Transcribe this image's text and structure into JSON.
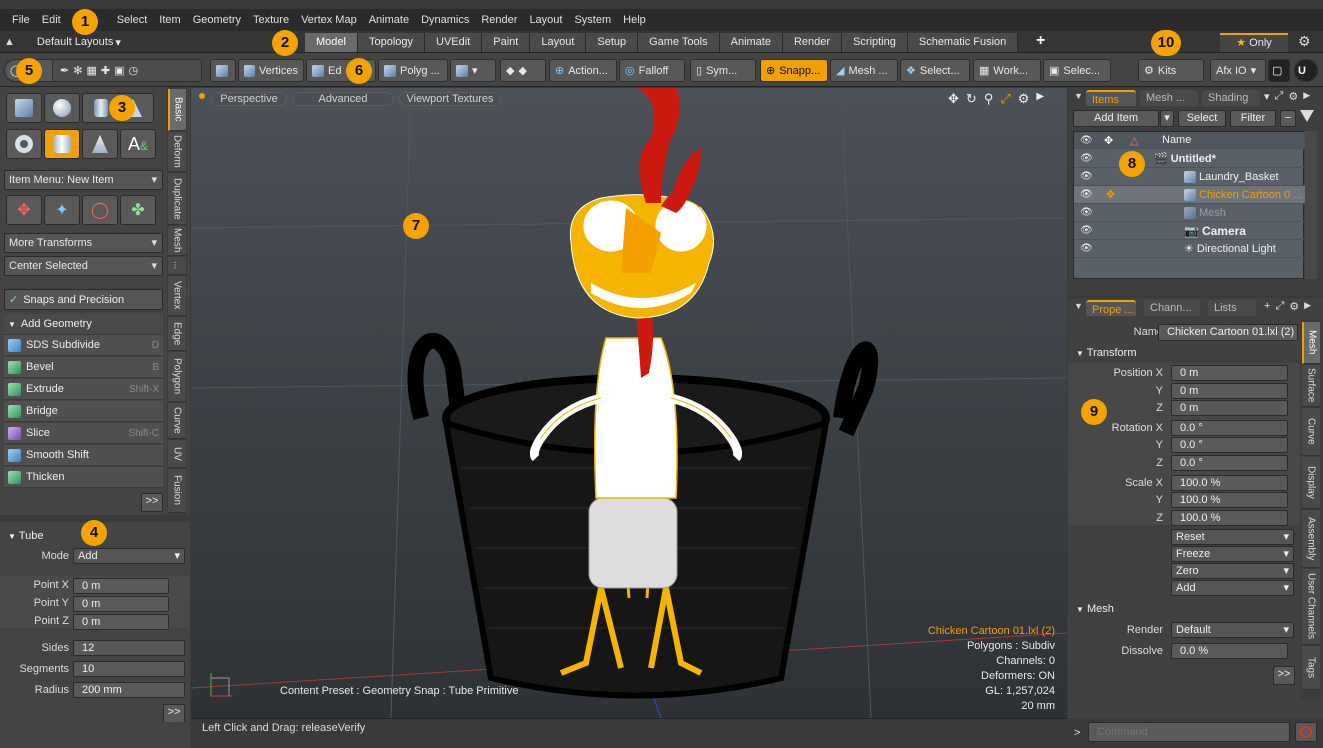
{
  "menu": [
    "File",
    "Edit",
    "Select",
    "Item",
    "Geometry",
    "Texture",
    "Vertex Map",
    "Animate",
    "Dynamics",
    "Render",
    "Layout",
    "System",
    "Help"
  ],
  "layout_dropdown": "Default Layouts",
  "layout_tabs": [
    "Model",
    "Topology",
    "UVEdit",
    "Paint",
    "Layout",
    "Setup",
    "Game Tools",
    "Animate",
    "Render",
    "Scripting",
    "Schematic Fusion"
  ],
  "only_label": "Only",
  "toolbar": {
    "vertices": "Vertices",
    "edges": "Ed",
    "polygons": "Polyg ...",
    "action": "Action...",
    "falloff": "Falloff",
    "symmetry": "Sym...",
    "snapping": "Snapp...",
    "mesh": "Mesh ...",
    "select": "Select...",
    "work": "Work...",
    "selec2": "Selec...",
    "kits": "Kits",
    "afxio": "Afx IO"
  },
  "left": {
    "item_menu": "Item Menu: New Item",
    "more_transforms": "More Transforms",
    "center_selected": "Center Selected",
    "snaps": "Snaps and Precision",
    "add_geometry": "Add Geometry",
    "tools": [
      {
        "label": "SDS Subdivide",
        "shortcut": "D"
      },
      {
        "label": "Bevel",
        "shortcut": "B"
      },
      {
        "label": "Extrude",
        "shortcut": "Shift-X"
      },
      {
        "label": "Bridge",
        "shortcut": ""
      },
      {
        "label": "Slice",
        "shortcut": "Shift-C"
      },
      {
        "label": "Smooth Shift",
        "shortcut": ""
      },
      {
        "label": "Thicken",
        "shortcut": ""
      }
    ],
    "more": ">>",
    "vtabs": [
      "Basic",
      "Deform",
      "Duplicate",
      "Mesh",
      "...",
      "Vertex",
      "Edge",
      "Polygon",
      "Curve",
      "UV",
      "Fusion"
    ]
  },
  "tube": {
    "title": "Tube",
    "mode_label": "Mode",
    "mode_value": "Add",
    "point_x_label": "Point X",
    "point_x": "0 m",
    "point_y_label": "Point Y",
    "point_y": "0 m",
    "point_z_label": "Point Z",
    "point_z": "0 m",
    "sides_label": "Sides",
    "sides": "12",
    "segments_label": "Segments",
    "segments": "10",
    "radius_label": "Radius",
    "radius": "200 mm",
    "more": ">>"
  },
  "viewport": {
    "perspective": "Perspective",
    "advanced": "Advanced",
    "textures": "Viewport Textures",
    "preset": "Content Preset : Geometry Snap : Tube Primitive",
    "info_selected": "Chicken Cartoon 01.lxl (2)",
    "info_lines": [
      "Polygons : Subdiv",
      "Channels: 0",
      "Deformers: ON",
      "GL: 1,257,024",
      "20 mm"
    ]
  },
  "status": "Left Click and Drag:  releaseVerify",
  "items_panel": {
    "tabs": [
      "Items",
      "Mesh ...",
      "Shading"
    ],
    "add_item": "Add Item",
    "select": "Select",
    "filter": "Filter",
    "name_col": "Name",
    "rows": [
      "Untitled*",
      "Laundry_Basket",
      "Chicken Cartoon 0 ...",
      "Mesh",
      "Camera",
      "Directional Light"
    ]
  },
  "props": {
    "tabs": [
      "Prope ...",
      "Chann...",
      "Lists"
    ],
    "name_label": "Name",
    "name_value": "Chicken Cartoon 01.lxl (2)",
    "transform": "Transform",
    "pos_x_label": "Position X",
    "pos_x": "0 m",
    "pos_y_label": "Y",
    "pos_y": "0 m",
    "pos_z_label": "Z",
    "pos_z": "0 m",
    "rot_x_label": "Rotation X",
    "rot_x": "0.0 °",
    "rot_y_label": "Y",
    "rot_y": "0.0 °",
    "rot_z_label": "Z",
    "rot_z": "0.0 °",
    "scl_x_label": "Scale X",
    "scl_x": "100.0 %",
    "scl_y_label": "Y",
    "scl_y": "100.0 %",
    "scl_z_label": "Z",
    "scl_z": "100.0 %",
    "reset": "Reset",
    "freeze": "Freeze",
    "zero": "Zero",
    "add": "Add",
    "mesh": "Mesh",
    "render_label": "Render",
    "render_value": "Default",
    "dissolve_label": "Dissolve",
    "dissolve_value": "0.0 %",
    "vtabs": [
      "Mesh",
      "Surface",
      "Curve",
      "Display",
      "Assembly",
      "User Channels",
      "Tags"
    ],
    "more": ">>"
  },
  "command_placeholder": "Command",
  "badges": [
    "1",
    "2",
    "3",
    "4",
    "5",
    "6",
    "7",
    "8",
    "9",
    "10"
  ],
  "colors": {
    "accent": "#f0a000",
    "badge": "#f5a300",
    "viewport": "#3e4348",
    "chicken_red": "#cc1a10",
    "chicken_yellow": "#f5b400"
  }
}
